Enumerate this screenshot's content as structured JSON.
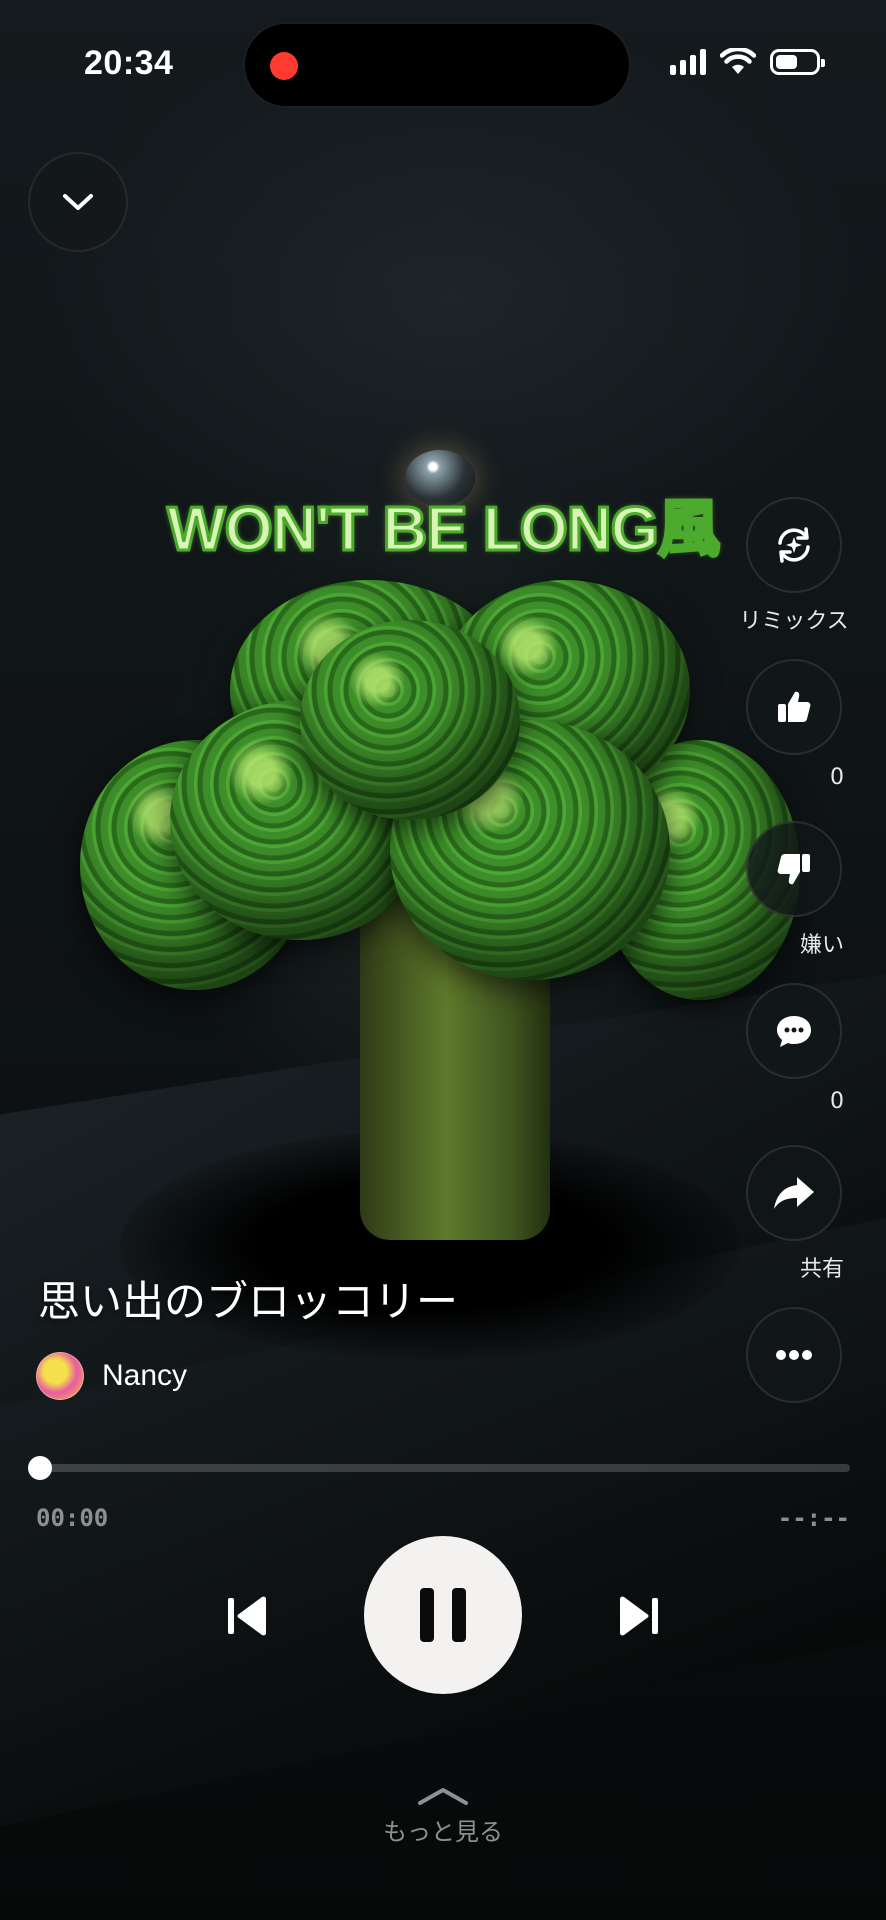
{
  "status_bar": {
    "time": "20:34",
    "recording_color": "#ff3b30",
    "battery_level": 0.55,
    "icons": [
      "signal-icon",
      "wifi-icon",
      "battery-icon"
    ]
  },
  "artwork": {
    "overlay_title": "WON'T BE LONG風"
  },
  "actions": {
    "remix_label": "リミックス",
    "like_count": "0",
    "dislike_label": "嫌い",
    "comment_count": "0",
    "share_label": "共有"
  },
  "track": {
    "title": "思い出のブロッコリー",
    "artist": "Nancy"
  },
  "playback": {
    "elapsed": "00:00",
    "remaining": "--:--",
    "progress": 0.0,
    "state": "playing"
  },
  "footer": {
    "more_label": "もっと見る"
  },
  "colors": {
    "accent_green": "#4caa2c",
    "play_button_bg": "#f4f2f1"
  }
}
